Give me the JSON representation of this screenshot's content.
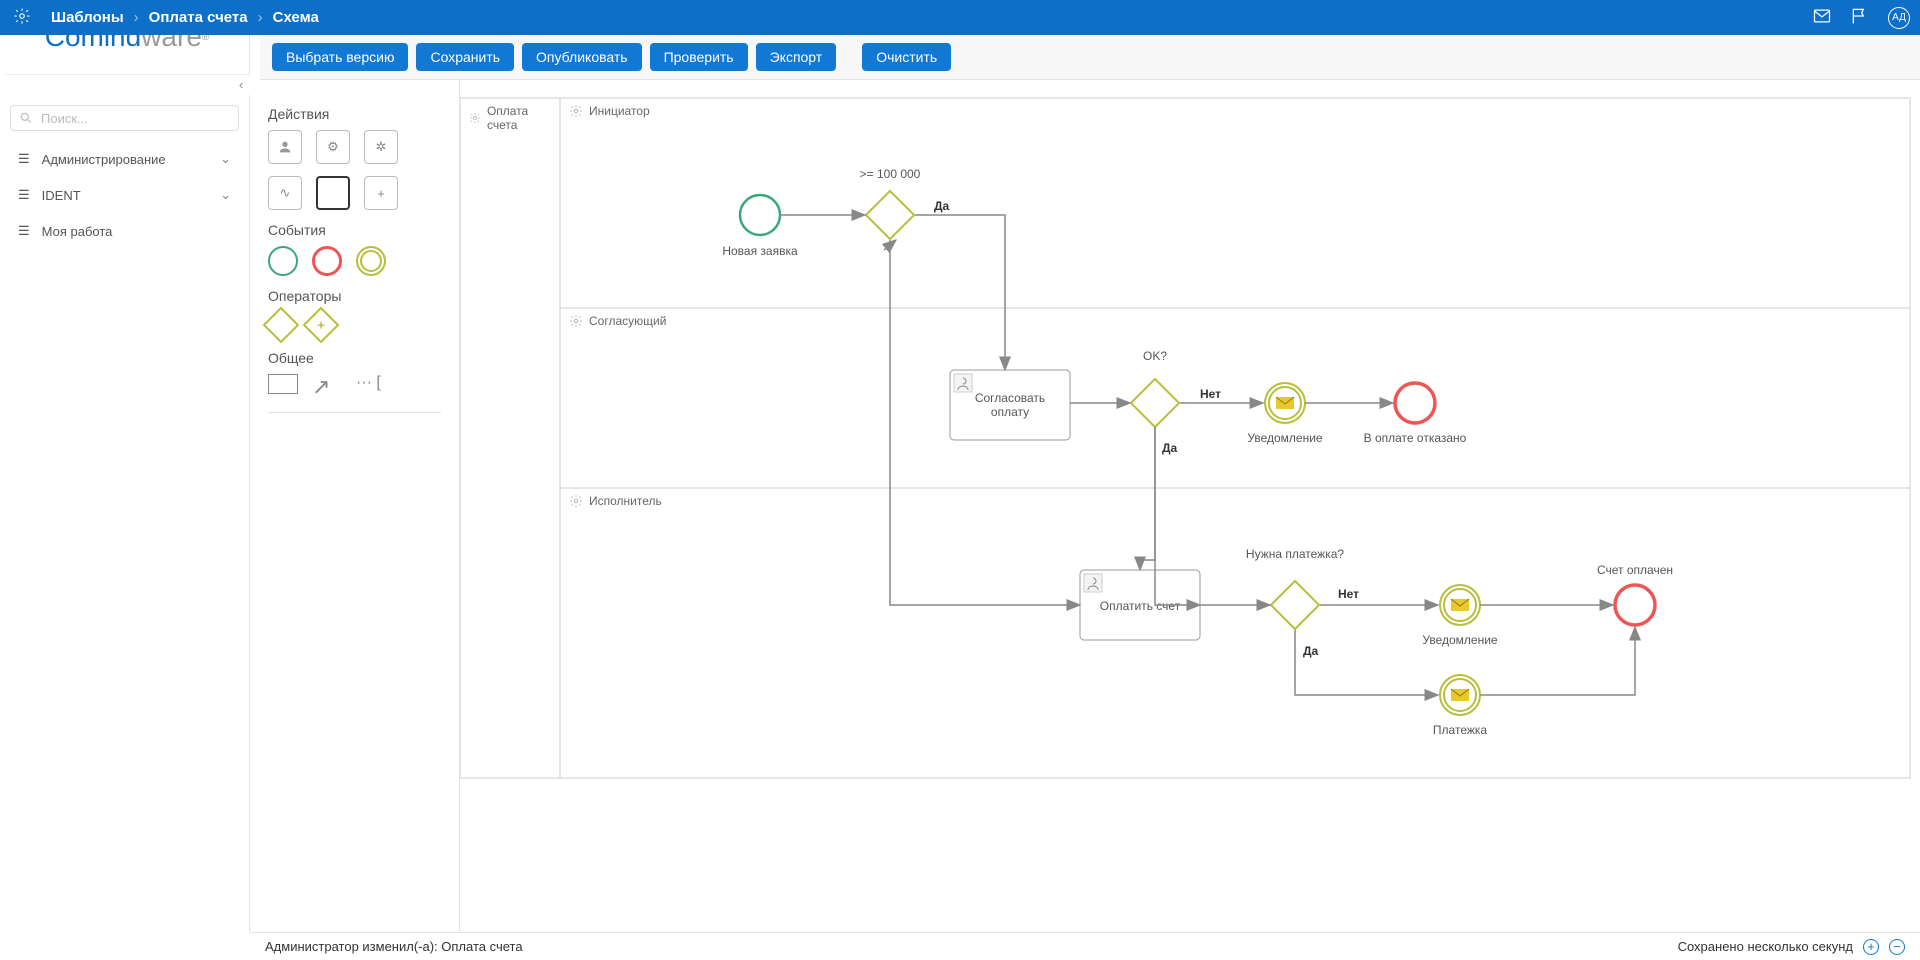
{
  "header": {
    "breadcrumbs": [
      "Шаблоны",
      "Оплата счета",
      "Схема"
    ],
    "avatar": "АД"
  },
  "toolbar": {
    "version": "Выбрать версию",
    "save": "Сохранить",
    "publish": "Опубликовать",
    "check": "Проверить",
    "export": "Экспорт",
    "clear": "Очистить"
  },
  "search": {
    "placeholder": "Поиск..."
  },
  "nav": {
    "admin": "Администрирование",
    "ident": "IDENT",
    "mywork": "Моя работа"
  },
  "palette": {
    "actions": "Действия",
    "events": "События",
    "operators": "Операторы",
    "general": "Общее"
  },
  "bpmn": {
    "pool": "Оплата счета",
    "lanes": {
      "initiator": "Инициатор",
      "approver": "Согласующий",
      "executor": "Исполнитель"
    },
    "nodes": {
      "start": "Новая заявка",
      "g1": ">= 100 000",
      "task_approve": "Согласовать оплату",
      "g2": "OK?",
      "notify1": "Уведомление",
      "end_reject": "В оплате отказано",
      "task_pay": "Оплатить счет",
      "g3": "Нужна платежка?",
      "notify2": "Уведомление",
      "payslip": "Платежка",
      "end_paid": "Счет оплачен"
    },
    "edges": {
      "yes1": "Да",
      "no2": "Нет",
      "yes2": "Да",
      "no3": "Нет",
      "yes3": "Да"
    }
  },
  "footer": {
    "status": "Администратор изменил(-а): Оплата счета",
    "saved": "Сохранено несколько секунд"
  }
}
